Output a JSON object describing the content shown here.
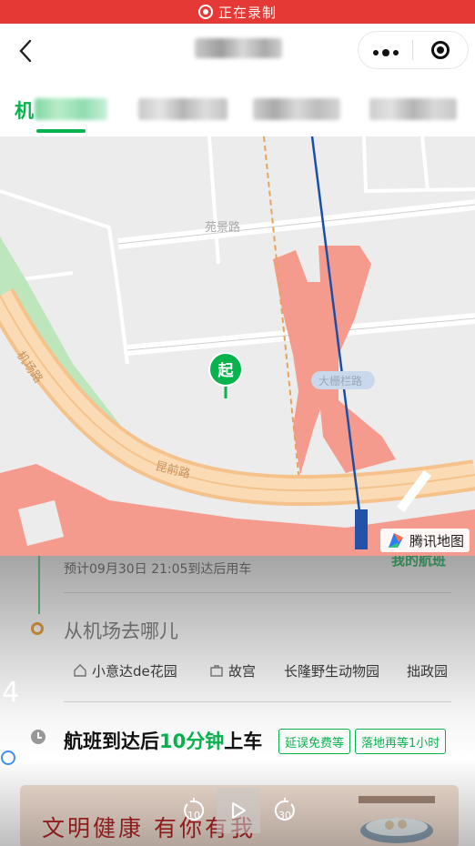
{
  "recording_bar": {
    "text": "正在录制"
  },
  "nav": {
    "back_icon": "chevron-left-icon",
    "more_icon": "more-dots-icon",
    "close_icon": "target-close-icon"
  },
  "tabs": {
    "first_label_partial": "机"
  },
  "map": {
    "start_marker": "起",
    "roads": [
      "苑景路",
      "大栅栏路",
      "昆前路",
      "机场路"
    ],
    "logo_text": "腾讯地图"
  },
  "sheet": {
    "arrival": "预计09月30日 21:05到达后用车",
    "flight_link": "我的航班",
    "destination_prompt": "从机场去哪儿",
    "destinations": [
      "小意达de花园",
      "故宫",
      "长隆野生动物园",
      "拙政园"
    ],
    "pickup_prefix": "航班到达后",
    "pickup_highlight": "10分钟",
    "pickup_suffix": "上车",
    "badge_delay": "延误免费等",
    "badge_wait": "落地再等1小时",
    "banner_text": "文明健康 有你有我"
  },
  "player": {
    "side_number": "4",
    "rewind_label": "10",
    "forward_label": "30"
  },
  "colors": {
    "accent_green": "#07b34d",
    "record_red": "#e53935",
    "marker_orange": "#e89a27"
  }
}
